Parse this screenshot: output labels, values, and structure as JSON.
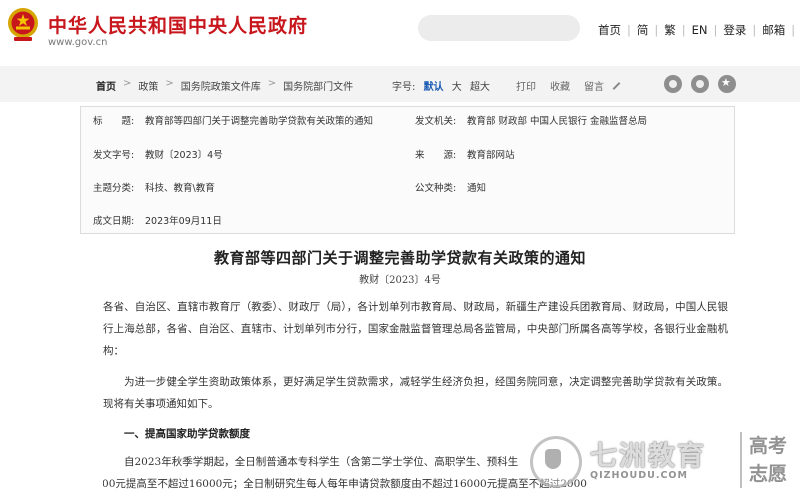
{
  "header": {
    "site_title": "中华人民共和国中央人民政府",
    "site_url": "www.gov.cn",
    "search_placeholder": "",
    "links": [
      "首页",
      "简",
      "繁",
      "EN",
      "登录",
      "邮箱",
      "无"
    ]
  },
  "breadcrumb": {
    "items": [
      "首页",
      "政策",
      "国务院政策文件库",
      "国务院部门文件"
    ],
    "separator": ">"
  },
  "font_size": {
    "label": "字号:",
    "options": [
      "默认",
      "大",
      "超大"
    ],
    "active": "默认"
  },
  "tools": {
    "print": "打印",
    "favorite": "收藏",
    "comment": "留言"
  },
  "share_icons": [
    "weibo-icon",
    "wechat-icon",
    "star-icon"
  ],
  "info": {
    "title_label": "标　　题:",
    "title_value": "教育部等四部门关于调整完善助学贷款有关政策的通知",
    "issuer_label": "发文机关:",
    "issuer_value": "教育部  财政部  中国人民银行  金融监督总局",
    "docno_label": "发文字号:",
    "docno_value": "教财〔2023〕4号",
    "source_label": "来　　源:",
    "source_value": "教育部网站",
    "topic_label": "主题分类:",
    "topic_value": "科技、教育\\教育",
    "kind_label": "公文种类:",
    "kind_value": "通知",
    "date_label": "成文日期:",
    "date_value": "2023年09月11日"
  },
  "document": {
    "title": "教育部等四部门关于调整完善助学贷款有关政策的通知",
    "number": "教财〔2023〕4号",
    "para1": "各省、自治区、直辖市教育厅（教委）、财政厅（局），各计划单列市教育局、财政局，新疆生产建设兵团教育局、财政局，中国人民银行上海总部，各省、自治区、直辖市、计划单列市分行，国家金融监督管理总局各监管局，中央部门所属各高等学校，各银行业金融机构：",
    "para2": "为进一步健全学生资助政策体系，更好满足学生贷款需求，减轻学生经济负担，经国务院同意，决定调整完善助学贷款有关政策。现将有关事项通知如下。",
    "heading1": "一、提高国家助学贷款额度",
    "para3_line1": "自2023年秋季学期起，全日制普通本专科学生（含第二学士学位、高职学生、预科生",
    "para3_line2": "12000元提高至不超过16000元；全日制研究生每人每年申请贷款额度由不超过16000元提高至不超过2000"
  },
  "watermark": {
    "main": "七洲教育",
    "domain": "QIZHOUDU.COM",
    "side_top": "高考",
    "side_bottom": "志愿"
  }
}
